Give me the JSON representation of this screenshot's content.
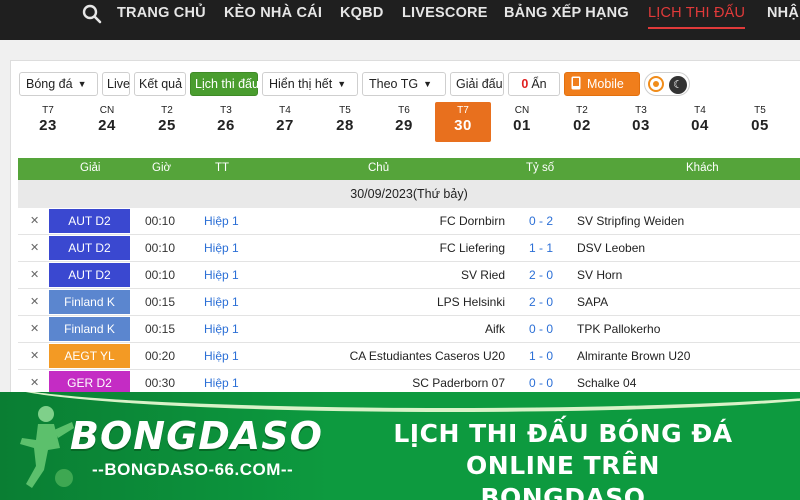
{
  "nav": {
    "items": [
      {
        "label": "TRANG CHỦ"
      },
      {
        "label": "KÈO NHÀ CÁI"
      },
      {
        "label": "KQBD"
      },
      {
        "label": "LIVESCORE"
      },
      {
        "label": "BẢNG XẾP HẠNG"
      },
      {
        "label": "LỊCH THI ĐẤU",
        "active": true
      },
      {
        "label": "NHẬ"
      }
    ]
  },
  "filters": {
    "sport": "Bóng đá",
    "live": "Live",
    "results": "Kết quả",
    "schedule": "Lịch thi đấu",
    "show": "Hiển thị hết",
    "sort": "Theo TG",
    "tournaments": "Giải đấu",
    "hidden_count": "0",
    "hidden_label": "Ẩn",
    "mobile": "Mobile"
  },
  "dates": [
    {
      "dow": "T7",
      "day": "23"
    },
    {
      "dow": "CN",
      "day": "24"
    },
    {
      "dow": "T2",
      "day": "25"
    },
    {
      "dow": "T3",
      "day": "26"
    },
    {
      "dow": "T4",
      "day": "27"
    },
    {
      "dow": "T5",
      "day": "28"
    },
    {
      "dow": "T6",
      "day": "29"
    },
    {
      "dow": "T7",
      "day": "30",
      "active": true
    },
    {
      "dow": "CN",
      "day": "01"
    },
    {
      "dow": "T2",
      "day": "02"
    },
    {
      "dow": "T3",
      "day": "03"
    },
    {
      "dow": "T4",
      "day": "04"
    },
    {
      "dow": "T5",
      "day": "05"
    }
  ],
  "table": {
    "headers": {
      "league": "Giải",
      "time": "Giờ",
      "status": "TT",
      "home": "Chủ",
      "score": "Tỷ số",
      "away": "Khách"
    },
    "date_label": "30/09/2023(Thứ bảy)",
    "rows": [
      {
        "league": "AUT D2",
        "color": "#3a48d0",
        "time": "00:10",
        "status": "Hiệp 1",
        "home": "FC Dornbirn",
        "score": "0 - 2",
        "away": "SV Stripfing Weiden"
      },
      {
        "league": "AUT D2",
        "color": "#3a48d0",
        "time": "00:10",
        "status": "Hiệp 1",
        "home": "FC Liefering",
        "score": "1 - 1",
        "away": "DSV Leoben"
      },
      {
        "league": "AUT D2",
        "color": "#3a48d0",
        "time": "00:10",
        "status": "Hiệp 1",
        "home": "SV Ried",
        "score": "2 - 0",
        "away": "SV Horn"
      },
      {
        "league": "Finland K",
        "color": "#5b86cf",
        "time": "00:15",
        "status": "Hiệp 1",
        "home": "LPS Helsinki",
        "score": "2 - 0",
        "away": "SAPA"
      },
      {
        "league": "Finland K",
        "color": "#5b86cf",
        "time": "00:15",
        "status": "Hiệp 1",
        "home": "Aifk",
        "score": "0 - 0",
        "away": "TPK Pallokerho"
      },
      {
        "league": "AEGT YL",
        "color": "#f39a24",
        "time": "00:20",
        "status": "Hiệp 1",
        "home": "CA Estudiantes Caseros U20",
        "score": "1 - 0",
        "away": "Almirante Brown U20"
      },
      {
        "league": "GER D2",
        "color": "#c42cc4",
        "time": "00:30",
        "status": "Hiệp 1",
        "home": "SC Paderborn 07",
        "score": "0 - 0",
        "away": "Schalke 04"
      }
    ]
  },
  "banner": {
    "logo_text": "BONGDASO",
    "url": "--BONGDASO-66.COM--",
    "headline_line1": "LỊCH THI ĐẤU BÓNG ĐÁ ONLINE TRÊN",
    "headline_line2": "BONGDASO"
  },
  "colors": {
    "nav_bg": "#1f1f1f",
    "active_red": "#e03a3a",
    "green": "#4a9d2f",
    "orange": "#f07e1c",
    "link_blue": "#2b6fd6",
    "banner_green": "#0d9a3f"
  }
}
